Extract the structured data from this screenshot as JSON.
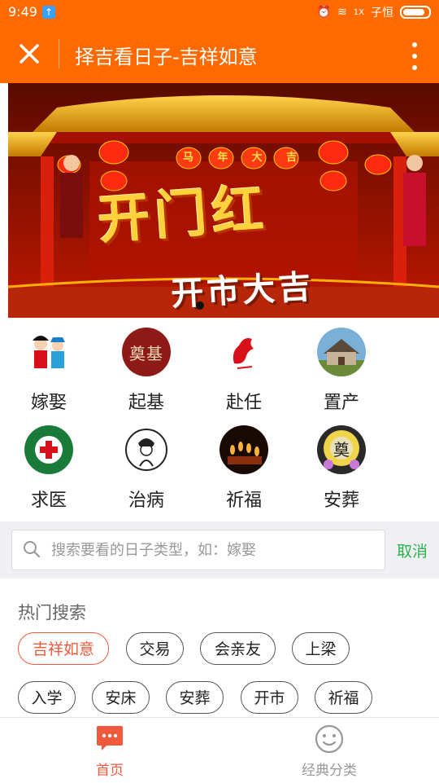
{
  "status_bar": {
    "time": "9:49",
    "carrier": "子恒",
    "network": "1X"
  },
  "header": {
    "title": "择吉看日子-吉祥如意",
    "close_icon": "close-icon",
    "more_icon": "more-vertical-icon",
    "bg_color": "#ff6a00"
  },
  "banner": {
    "headline": "开门红",
    "subline": "开市大吉",
    "lantern_text": [
      "马",
      "年",
      "大",
      "吉"
    ]
  },
  "categories": [
    {
      "label": "嫁娶",
      "icon": "wedding-couple-icon"
    },
    {
      "label": "起基",
      "icon": "foundation-seal-icon",
      "icon_text": "奠基"
    },
    {
      "label": "赴任",
      "icon": "horse-calligraphy-icon"
    },
    {
      "label": "置产",
      "icon": "house-icon"
    },
    {
      "label": "求医",
      "icon": "medical-cross-icon"
    },
    {
      "label": "治病",
      "icon": "doctor-portrait-icon"
    },
    {
      "label": "祈福",
      "icon": "candles-icon"
    },
    {
      "label": "安葬",
      "icon": "funeral-wreath-icon",
      "icon_text": "奠"
    }
  ],
  "search": {
    "placeholder": "搜索要看的日子类型，如：嫁娶",
    "value": "",
    "cancel_label": "取消"
  },
  "hot_search": {
    "title": "热门搜索",
    "tags": [
      "吉祥如意",
      "交易",
      "会亲友",
      "上梁",
      "入学",
      "安床",
      "安葬",
      "开市",
      "祈福"
    ],
    "active_tag": "吉祥如意"
  },
  "tabbar": {
    "tabs": [
      {
        "label": "首页",
        "icon": "chat-bubble-icon",
        "active": true
      },
      {
        "label": "经典分类",
        "icon": "smiley-icon",
        "active": false
      }
    ],
    "active_color": "#f05a3c",
    "inactive_color": "#999999"
  }
}
